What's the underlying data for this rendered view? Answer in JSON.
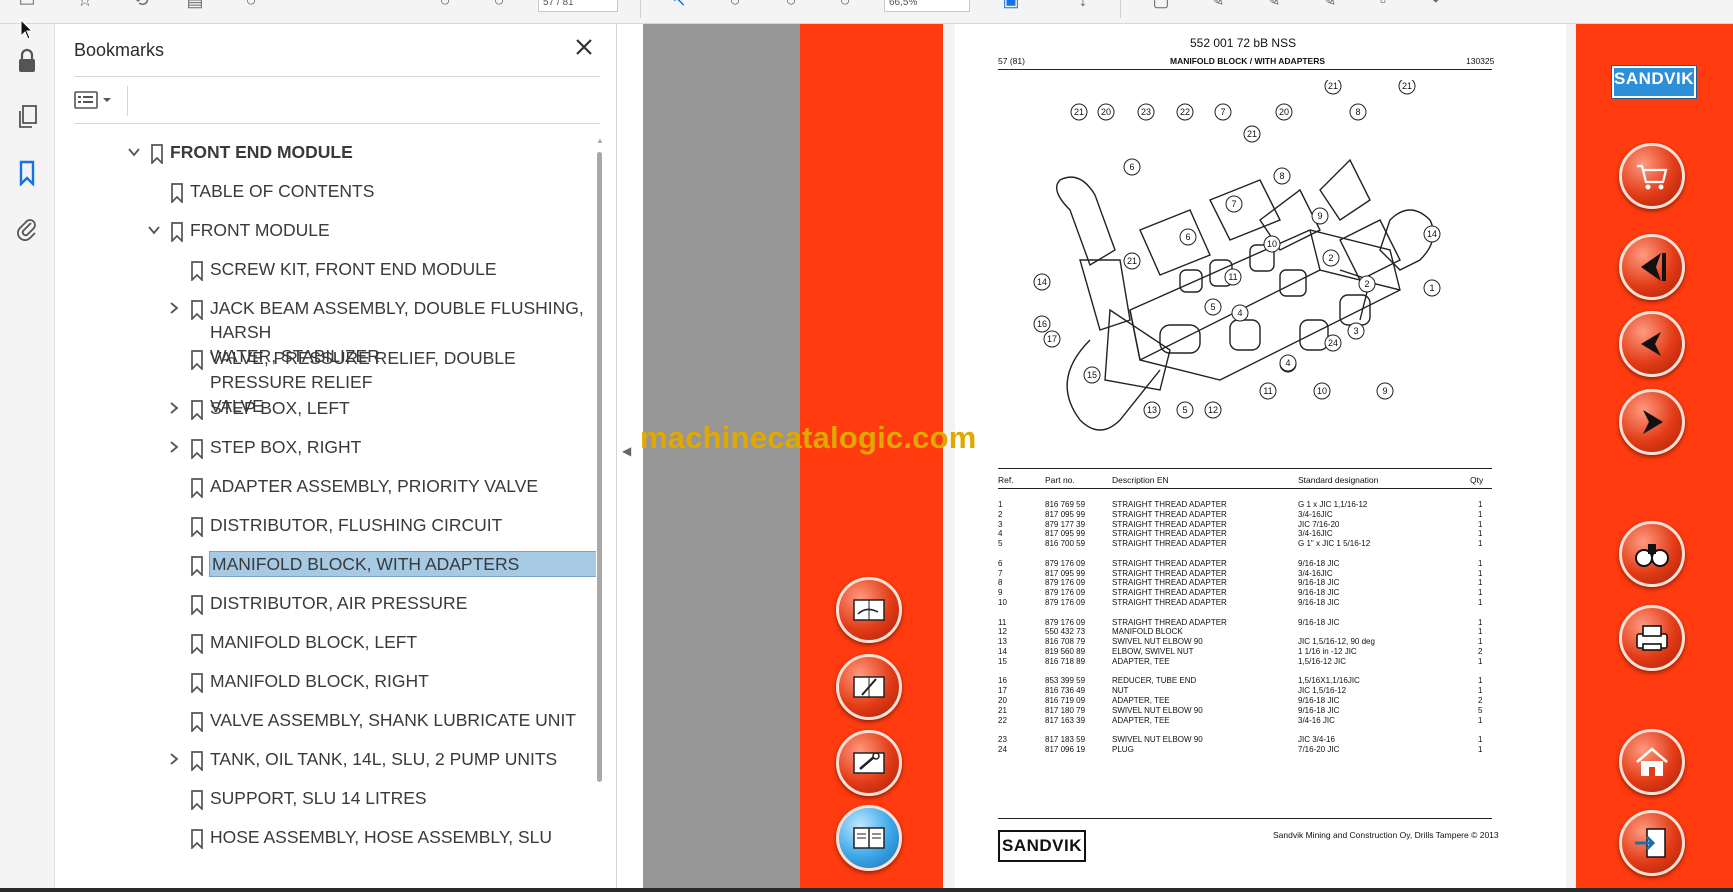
{
  "toolbar": {
    "page_field": "57 / 81",
    "zoom_field": "66,5%"
  },
  "bookmarks_panel": {
    "title": "Bookmarks",
    "items": [
      {
        "label": "FRONT END MODULE",
        "level": 0,
        "expander": "expanded",
        "bold": true
      },
      {
        "label": "TABLE OF CONTENTS",
        "level": 1,
        "expander": "none"
      },
      {
        "label": "FRONT MODULE",
        "level": 1,
        "expander": "expanded"
      },
      {
        "label": "SCREW KIT, FRONT END MODULE",
        "level": 2,
        "expander": "none"
      },
      {
        "label": "JACK BEAM ASSEMBLY, DOUBLE FLUSHING, HARSH",
        "label2": "WATER, STABILIZER",
        "level": 2,
        "expander": "collapsed"
      },
      {
        "label": "VALVE, PRESSURE RELIEF, DOUBLE PRESSURE RELIEF",
        "label2": "VALVE",
        "level": 2,
        "expander": "none"
      },
      {
        "label": "STEP BOX, LEFT",
        "level": 2,
        "expander": "collapsed"
      },
      {
        "label": "STEP BOX, RIGHT",
        "level": 2,
        "expander": "collapsed"
      },
      {
        "label": "ADAPTER ASSEMBLY, PRIORITY VALVE",
        "level": 2,
        "expander": "none"
      },
      {
        "label": "DISTRIBUTOR, FLUSHING CIRCUIT",
        "level": 2,
        "expander": "none"
      },
      {
        "label": "MANIFOLD BLOCK, WITH ADAPTERS",
        "level": 2,
        "expander": "none",
        "selected": true
      },
      {
        "label": "DISTRIBUTOR, AIR PRESSURE",
        "level": 2,
        "expander": "none"
      },
      {
        "label": "MANIFOLD BLOCK, LEFT",
        "level": 2,
        "expander": "none"
      },
      {
        "label": "MANIFOLD BLOCK, RIGHT",
        "level": 2,
        "expander": "none"
      },
      {
        "label": "VALVE ASSEMBLY, SHANK LUBRICATE UNIT",
        "level": 2,
        "expander": "none"
      },
      {
        "label": "TANK, OIL TANK, 14L, SLU, 2 PUMP UNITS",
        "level": 2,
        "expander": "collapsed"
      },
      {
        "label": "SUPPORT, SLU 14 LITRES",
        "level": 2,
        "expander": "none"
      },
      {
        "label": "HOSE ASSEMBLY, HOSE ASSEMBLY, SLU",
        "level": 2,
        "expander": "none"
      }
    ]
  },
  "document": {
    "doc_code": "552 001 72 bB NSS",
    "page_num": "57 (81)",
    "heading": "MANIFOLD BLOCK / WITH ADAPTERS",
    "date": "130325",
    "table_headers": {
      "ref": "Ref.",
      "part": "Part no.",
      "desc": "Description EN",
      "std": "Standard designation",
      "qty": "Qty"
    },
    "parts": [
      {
        "ref": "1",
        "part": "816 769 59",
        "desc": "STRAIGHT THREAD ADAPTER",
        "std": "G 1 x JIC 1,1/16-12",
        "qty": "1"
      },
      {
        "ref": "2",
        "part": "817 095 99",
        "desc": "STRAIGHT THREAD ADAPTER",
        "std": "3/4-16JIC",
        "qty": "1"
      },
      {
        "ref": "3",
        "part": "879 177 39",
        "desc": "STRAIGHT THREAD ADAPTER",
        "std": "JIC 7/16-20",
        "qty": "1"
      },
      {
        "ref": "4",
        "part": "817 095 99",
        "desc": "STRAIGHT THREAD ADAPTER",
        "std": "3/4-16JIC",
        "qty": "1"
      },
      {
        "ref": "5",
        "part": "816 700 59",
        "desc": "STRAIGHT THREAD ADAPTER",
        "std": "G 1\" x JIC 1 5/16-12",
        "qty": "1"
      },
      {
        "ref": "6",
        "part": "879 176 09",
        "desc": "STRAIGHT THREAD ADAPTER",
        "std": "9/16-18 JIC",
        "qty": "1"
      },
      {
        "ref": "7",
        "part": "817 095 99",
        "desc": "STRAIGHT THREAD ADAPTER",
        "std": "3/4-16JIC",
        "qty": "1"
      },
      {
        "ref": "8",
        "part": "879 176 09",
        "desc": "STRAIGHT THREAD ADAPTER",
        "std": "9/16-18 JIC",
        "qty": "1"
      },
      {
        "ref": "9",
        "part": "879 176 09",
        "desc": "STRAIGHT THREAD ADAPTER",
        "std": "9/16-18 JIC",
        "qty": "1"
      },
      {
        "ref": "10",
        "part": "879 176 09",
        "desc": "STRAIGHT THREAD ADAPTER",
        "std": "9/16-18 JIC",
        "qty": "1"
      },
      {
        "ref": "11",
        "part": "879 176 09",
        "desc": "STRAIGHT THREAD ADAPTER",
        "std": "9/16-18 JIC",
        "qty": "1"
      },
      {
        "ref": "12",
        "part": "550 432 73",
        "desc": "MANIFOLD BLOCK",
        "std": "",
        "qty": "1"
      },
      {
        "ref": "13",
        "part": "816 708 79",
        "desc": "SWIVEL NUT ELBOW 90",
        "std": "JIC 1,5/16-12, 90 deg",
        "qty": "1"
      },
      {
        "ref": "14",
        "part": "819 560 89",
        "desc": "ELBOW, SWIVEL NUT",
        "std": "1 1/16 in -12 JIC",
        "qty": "2"
      },
      {
        "ref": "15",
        "part": "816 718 89",
        "desc": "ADAPTER, TEE",
        "std": "1,5/16-12 JIC",
        "qty": "1"
      },
      {
        "ref": "16",
        "part": "853 399 59",
        "desc": "REDUCER, TUBE END",
        "std": "1,5/16X1,1/16JIC",
        "qty": "1"
      },
      {
        "ref": "17",
        "part": "816 736 49",
        "desc": "NUT",
        "std": "JIC 1,5/16-12",
        "qty": "1"
      },
      {
        "ref": "20",
        "part": "816 719 09",
        "desc": "ADAPTER, TEE",
        "std": "9/16-18 JIC",
        "qty": "2"
      },
      {
        "ref": "21",
        "part": "817 180 79",
        "desc": "SWIVEL NUT ELBOW 90",
        "std": "9/16-18 JIC",
        "qty": "5"
      },
      {
        "ref": "22",
        "part": "817 163 39",
        "desc": "ADAPTER, TEE",
        "std": "3/4-16 JIC",
        "qty": "1"
      },
      {
        "ref": "23",
        "part": "817 183 59",
        "desc": "SWIVEL NUT ELBOW 90",
        "std": "JIC 3/4-16",
        "qty": "1"
      },
      {
        "ref": "24",
        "part": "817 096 19",
        "desc": "PLUG",
        "std": "7/16-20 JIC",
        "qty": "1"
      }
    ],
    "callouts": [
      "21",
      "20",
      "23",
      "22",
      "7",
      "20",
      "21",
      "8",
      "21",
      "6",
      "21",
      "7",
      "8",
      "9",
      "14",
      "6",
      "10",
      "21",
      "14",
      "11",
      "2",
      "1",
      "5",
      "4",
      "3",
      "2",
      "16",
      "17",
      "24",
      "3",
      "15",
      "4",
      "11",
      "10",
      "9",
      "13",
      "5",
      "12"
    ],
    "logo_text": "SANDVIK",
    "footer": "Sandvik Mining and Construction Oy, Drills Tampere © 2013"
  },
  "watermark": "machinecatalogic.com",
  "nav_right": {
    "logo_text": "SANDVIK"
  }
}
